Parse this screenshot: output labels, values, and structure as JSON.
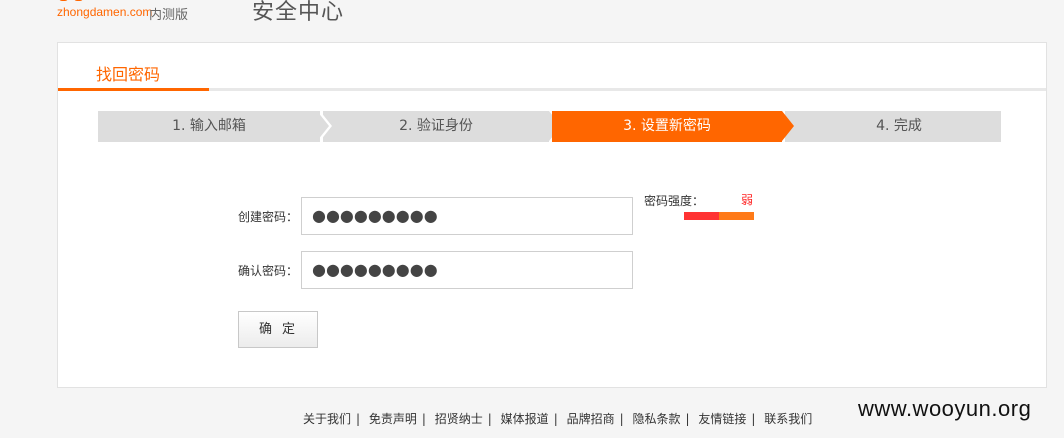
{
  "header": {
    "logo_domain": "zhongdamen.com",
    "logo_beta": "内测版",
    "site_title": "安全中心"
  },
  "tab": {
    "label": "找回密码"
  },
  "steps": [
    {
      "label": "1. 输入邮箱",
      "active": false
    },
    {
      "label": "2. 验证身份",
      "active": false
    },
    {
      "label": "3. 设置新密码",
      "active": true
    },
    {
      "label": "4. 完成",
      "active": false
    }
  ],
  "form": {
    "new_password_label": "创建密码：",
    "new_password_value": "●●●●●●●●●",
    "confirm_password_label": "确认密码：",
    "confirm_password_value": "●●●●●●●●●",
    "submit_label": "确定"
  },
  "strength": {
    "label": "密码强度：",
    "value": "弱",
    "level": 0.5,
    "weak_color": "#ff3333",
    "bar_color": "#ff7a18"
  },
  "footer": {
    "links": [
      "关于我们",
      "免责声明",
      "招贤纳士",
      "媒体报道",
      "品牌招商",
      "隐私条款",
      "友情链接",
      "联系我们"
    ],
    "separator": "|"
  },
  "watermark": "www.wooyun.org",
  "colors": {
    "accent": "#ff6600",
    "step_inactive": "#dddddd"
  }
}
